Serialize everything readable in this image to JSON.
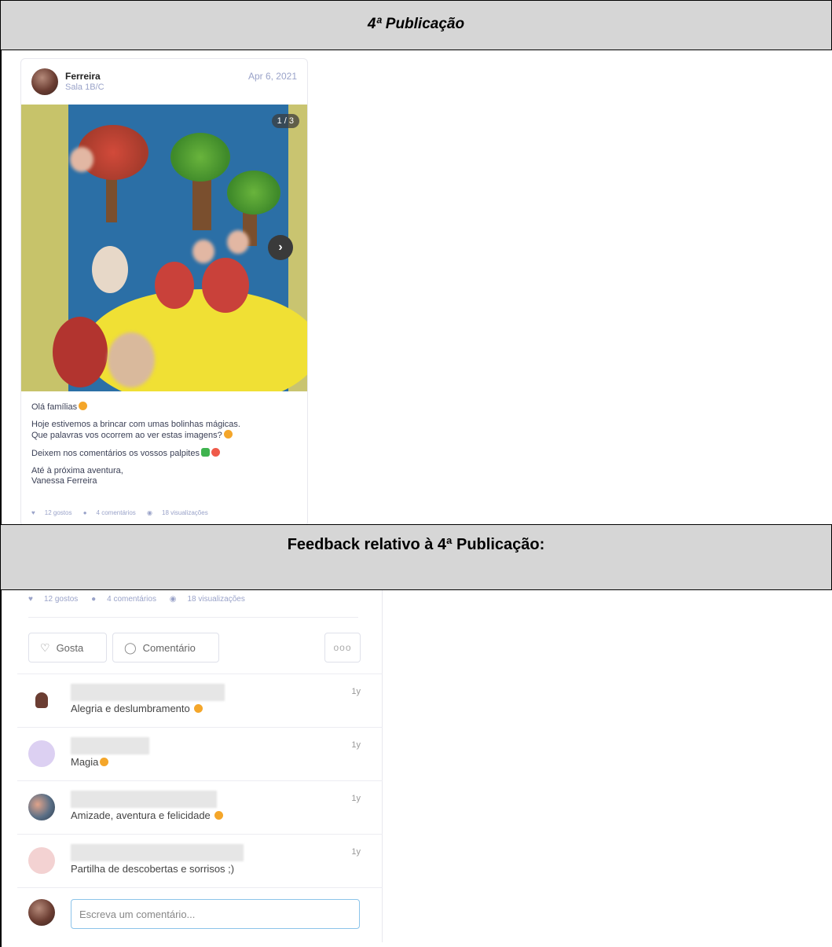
{
  "section1": {
    "title": "4ª Publicação"
  },
  "post": {
    "author": "Ferreira",
    "room": "Sala 1B/C",
    "date": "Apr 6, 2021",
    "image_counter": "1 / 3",
    "next_icon": "chevron-right-icon",
    "caption": {
      "line1": "Olá famílias",
      "line2a": "Hoje estivemos a brincar com umas bolinhas mágicas.",
      "line2b": "Que palavras vos ocorrem ao ver estas imagens?",
      "line3": "Deixem nos comentários os vossos palpites",
      "line4a": "Até à próxima aventura,",
      "line4b": "Vanessa Ferreira"
    },
    "stats": {
      "likes": "12 gostos",
      "comments": "4 comentários",
      "views": "18 visualizações"
    }
  },
  "section2": {
    "title": "Feedback relativo à 4ª Publicação:"
  },
  "feedback": {
    "stats": {
      "likes": "12 gostos",
      "comments": "4 comentários",
      "views": "18 visualizações"
    },
    "like_label": "Gosta",
    "comment_label": "Comentário",
    "more_label": "ooo",
    "comments": [
      {
        "text": "Alegria e deslumbramento",
        "time": "1y",
        "avatar_color": "#6b3d32"
      },
      {
        "text": "Magia",
        "time": "1y",
        "avatar_color": "#dcd0f2"
      },
      {
        "text": "Amizade, aventura e felicidade",
        "time": "1y",
        "avatar_color": "#5a6f86"
      },
      {
        "text": "Partilha de descobertas e sorrisos ;)",
        "time": "1y",
        "avatar_color": "#f3d2d2"
      }
    ],
    "input_placeholder": "Escreva um comentário..."
  }
}
